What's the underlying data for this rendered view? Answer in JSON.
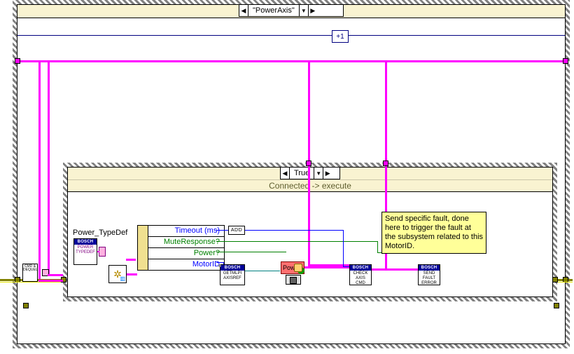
{
  "outer_case": {
    "selector_label": "\"PowerAxis\""
  },
  "inner_case": {
    "selector_label": "True",
    "subtitle": "Connected -> execute"
  },
  "unbundle": {
    "title": "Power_TypeDef",
    "rows": [
      "Timeout (ms)",
      "MuteResponse?",
      "Power?",
      "MotorID"
    ]
  },
  "comment": "Send specific fault, done here to trigger the fault at the subsystem related to this MotorID.",
  "nodes": {
    "brand": "BOSCH",
    "power_typedef": "POWER\nTYPEDEF",
    "cmd_dequeue": "CMD &\nDEQUEUE",
    "getmlpi": "GETMLPI\nAXISREF",
    "checkaxis": "CHECK\nAXIS\nCMD",
    "senderr": "SEND\nFAULT\nERROR",
    "power_btn": "Power",
    "add": "ADD",
    "inc": "+1"
  }
}
